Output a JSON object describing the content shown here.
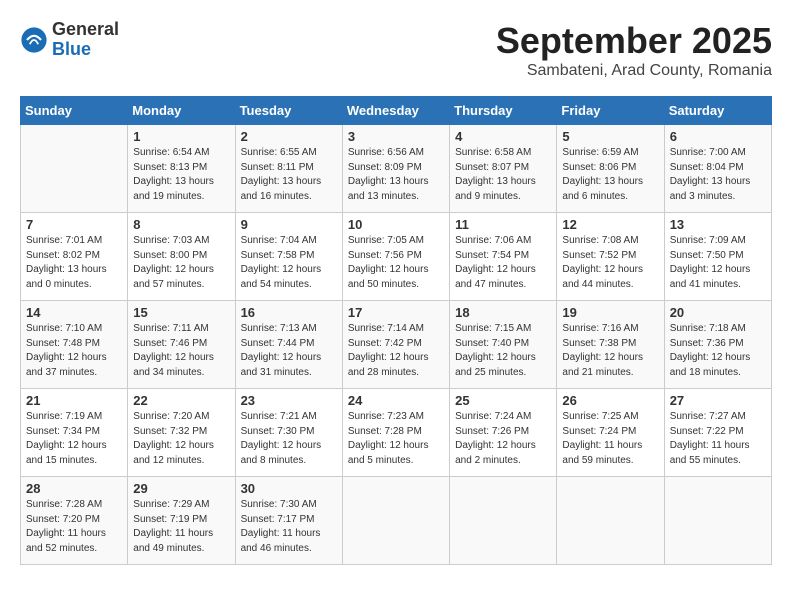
{
  "header": {
    "logo_general": "General",
    "logo_blue": "Blue",
    "month_title": "September 2025",
    "subtitle": "Sambateni, Arad County, Romania"
  },
  "days_of_week": [
    "Sunday",
    "Monday",
    "Tuesday",
    "Wednesday",
    "Thursday",
    "Friday",
    "Saturday"
  ],
  "weeks": [
    [
      {
        "day": "",
        "info": ""
      },
      {
        "day": "1",
        "info": "Sunrise: 6:54 AM\nSunset: 8:13 PM\nDaylight: 13 hours\nand 19 minutes."
      },
      {
        "day": "2",
        "info": "Sunrise: 6:55 AM\nSunset: 8:11 PM\nDaylight: 13 hours\nand 16 minutes."
      },
      {
        "day": "3",
        "info": "Sunrise: 6:56 AM\nSunset: 8:09 PM\nDaylight: 13 hours\nand 13 minutes."
      },
      {
        "day": "4",
        "info": "Sunrise: 6:58 AM\nSunset: 8:07 PM\nDaylight: 13 hours\nand 9 minutes."
      },
      {
        "day": "5",
        "info": "Sunrise: 6:59 AM\nSunset: 8:06 PM\nDaylight: 13 hours\nand 6 minutes."
      },
      {
        "day": "6",
        "info": "Sunrise: 7:00 AM\nSunset: 8:04 PM\nDaylight: 13 hours\nand 3 minutes."
      }
    ],
    [
      {
        "day": "7",
        "info": "Sunrise: 7:01 AM\nSunset: 8:02 PM\nDaylight: 13 hours\nand 0 minutes."
      },
      {
        "day": "8",
        "info": "Sunrise: 7:03 AM\nSunset: 8:00 PM\nDaylight: 12 hours\nand 57 minutes."
      },
      {
        "day": "9",
        "info": "Sunrise: 7:04 AM\nSunset: 7:58 PM\nDaylight: 12 hours\nand 54 minutes."
      },
      {
        "day": "10",
        "info": "Sunrise: 7:05 AM\nSunset: 7:56 PM\nDaylight: 12 hours\nand 50 minutes."
      },
      {
        "day": "11",
        "info": "Sunrise: 7:06 AM\nSunset: 7:54 PM\nDaylight: 12 hours\nand 47 minutes."
      },
      {
        "day": "12",
        "info": "Sunrise: 7:08 AM\nSunset: 7:52 PM\nDaylight: 12 hours\nand 44 minutes."
      },
      {
        "day": "13",
        "info": "Sunrise: 7:09 AM\nSunset: 7:50 PM\nDaylight: 12 hours\nand 41 minutes."
      }
    ],
    [
      {
        "day": "14",
        "info": "Sunrise: 7:10 AM\nSunset: 7:48 PM\nDaylight: 12 hours\nand 37 minutes."
      },
      {
        "day": "15",
        "info": "Sunrise: 7:11 AM\nSunset: 7:46 PM\nDaylight: 12 hours\nand 34 minutes."
      },
      {
        "day": "16",
        "info": "Sunrise: 7:13 AM\nSunset: 7:44 PM\nDaylight: 12 hours\nand 31 minutes."
      },
      {
        "day": "17",
        "info": "Sunrise: 7:14 AM\nSunset: 7:42 PM\nDaylight: 12 hours\nand 28 minutes."
      },
      {
        "day": "18",
        "info": "Sunrise: 7:15 AM\nSunset: 7:40 PM\nDaylight: 12 hours\nand 25 minutes."
      },
      {
        "day": "19",
        "info": "Sunrise: 7:16 AM\nSunset: 7:38 PM\nDaylight: 12 hours\nand 21 minutes."
      },
      {
        "day": "20",
        "info": "Sunrise: 7:18 AM\nSunset: 7:36 PM\nDaylight: 12 hours\nand 18 minutes."
      }
    ],
    [
      {
        "day": "21",
        "info": "Sunrise: 7:19 AM\nSunset: 7:34 PM\nDaylight: 12 hours\nand 15 minutes."
      },
      {
        "day": "22",
        "info": "Sunrise: 7:20 AM\nSunset: 7:32 PM\nDaylight: 12 hours\nand 12 minutes."
      },
      {
        "day": "23",
        "info": "Sunrise: 7:21 AM\nSunset: 7:30 PM\nDaylight: 12 hours\nand 8 minutes."
      },
      {
        "day": "24",
        "info": "Sunrise: 7:23 AM\nSunset: 7:28 PM\nDaylight: 12 hours\nand 5 minutes."
      },
      {
        "day": "25",
        "info": "Sunrise: 7:24 AM\nSunset: 7:26 PM\nDaylight: 12 hours\nand 2 minutes."
      },
      {
        "day": "26",
        "info": "Sunrise: 7:25 AM\nSunset: 7:24 PM\nDaylight: 11 hours\nand 59 minutes."
      },
      {
        "day": "27",
        "info": "Sunrise: 7:27 AM\nSunset: 7:22 PM\nDaylight: 11 hours\nand 55 minutes."
      }
    ],
    [
      {
        "day": "28",
        "info": "Sunrise: 7:28 AM\nSunset: 7:20 PM\nDaylight: 11 hours\nand 52 minutes."
      },
      {
        "day": "29",
        "info": "Sunrise: 7:29 AM\nSunset: 7:19 PM\nDaylight: 11 hours\nand 49 minutes."
      },
      {
        "day": "30",
        "info": "Sunrise: 7:30 AM\nSunset: 7:17 PM\nDaylight: 11 hours\nand 46 minutes."
      },
      {
        "day": "",
        "info": ""
      },
      {
        "day": "",
        "info": ""
      },
      {
        "day": "",
        "info": ""
      },
      {
        "day": "",
        "info": ""
      }
    ]
  ]
}
